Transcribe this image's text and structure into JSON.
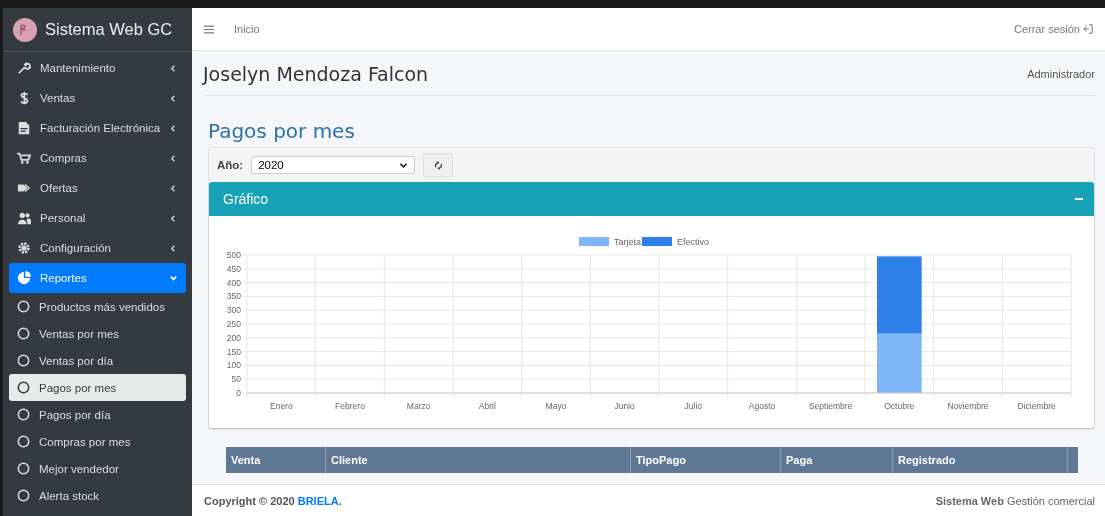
{
  "sidebar": {
    "brand": "Sistema Web GC",
    "items": [
      {
        "label": "Mantenimiento",
        "expanded": false,
        "selected": false
      },
      {
        "label": "Ventas",
        "expanded": false,
        "selected": false
      },
      {
        "label": "Facturación Electrónica",
        "expanded": false,
        "selected": false
      },
      {
        "label": "Compras",
        "expanded": false,
        "selected": false
      },
      {
        "label": "Ofertas",
        "expanded": false,
        "selected": false
      },
      {
        "label": "Personal",
        "expanded": false,
        "selected": false
      },
      {
        "label": "Configuración",
        "expanded": false,
        "selected": false
      },
      {
        "label": "Reportes",
        "expanded": true,
        "selected": true,
        "children": [
          {
            "label": "Productos más vendidos",
            "selected": false
          },
          {
            "label": "Ventas por mes",
            "selected": false
          },
          {
            "label": "Ventas por día",
            "selected": false
          },
          {
            "label": "Pagos por mes",
            "selected": true
          },
          {
            "label": "Pagos por día",
            "selected": false
          },
          {
            "label": "Compras por mes",
            "selected": false
          },
          {
            "label": "Mejor vendedor",
            "selected": false
          },
          {
            "label": "Alerta stock",
            "selected": false
          }
        ]
      }
    ]
  },
  "topbar": {
    "home": "Inicio",
    "logout": "Cerrar sesión"
  },
  "user": {
    "name": "Joselyn Mendoza Falcon",
    "role": "Administrador"
  },
  "page_title": "Pagos por mes",
  "filter": {
    "label": "Año:",
    "value": "2020"
  },
  "chart_panel": {
    "title": "Gráfico",
    "chart_data": {
      "type": "bar",
      "stacked": true,
      "categories": [
        "Enero",
        "Febrero",
        "Marzo",
        "Abril",
        "Mayo",
        "Junio",
        "Julio",
        "Agosto",
        "Septiembre",
        "Octubre",
        "Noviembre",
        "Diciembre"
      ],
      "series": [
        {
          "name": "Tarjeta",
          "color": "#7fb5fb",
          "values": [
            0,
            0,
            0,
            0,
            0,
            0,
            0,
            0,
            0,
            215,
            0,
            0
          ]
        },
        {
          "name": "Efectivo",
          "color": "#2e7fe8",
          "values": [
            0,
            0,
            0,
            0,
            0,
            0,
            0,
            0,
            0,
            280,
            0,
            0
          ]
        }
      ],
      "grid": true,
      "legend": true,
      "ylim": [
        0,
        500
      ],
      "yticks": [
        0,
        50,
        100,
        150,
        200,
        250,
        300,
        350,
        400,
        450,
        500
      ]
    }
  },
  "table": {
    "columns": [
      "Venta",
      "Cliente",
      "TipoPago",
      "Paga",
      "Registrado"
    ]
  },
  "footer": {
    "copyright": "Copyright © 2020",
    "link": "BRIELA",
    "suffix": ".",
    "right": "**Sistema Web** Gestión comercial"
  }
}
